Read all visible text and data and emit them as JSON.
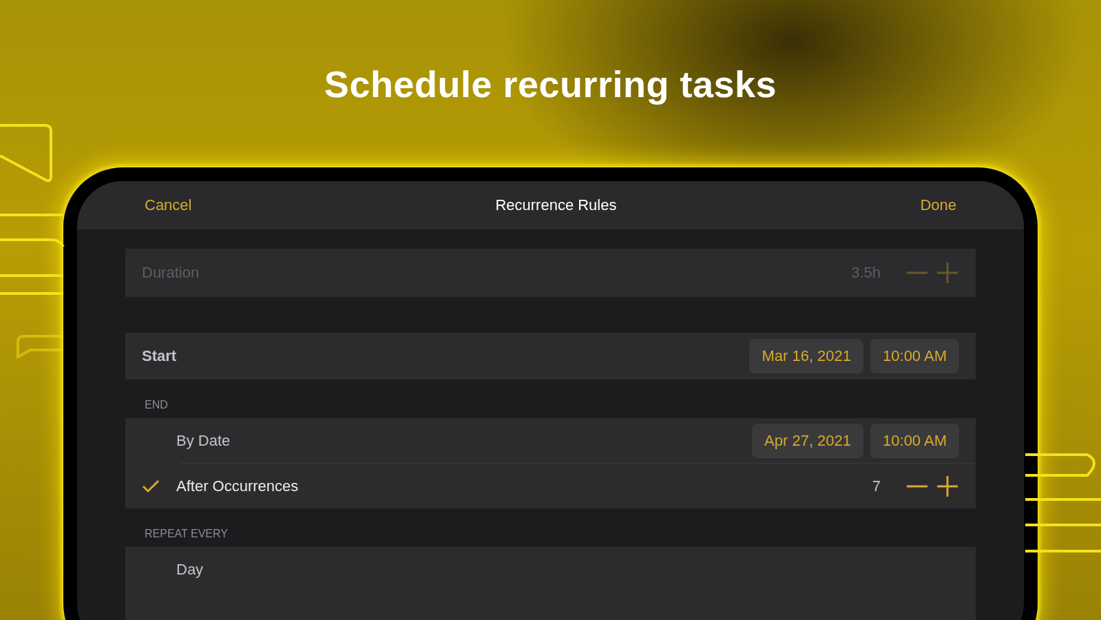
{
  "headline": "Schedule recurring tasks",
  "nav": {
    "cancel": "Cancel",
    "title": "Recurrence Rules",
    "done": "Done"
  },
  "duration": {
    "label": "Duration",
    "value": "3.5h",
    "disabled": true
  },
  "start": {
    "label": "Start",
    "date": "Mar 16, 2021",
    "time": "10:00 AM"
  },
  "end": {
    "header": "END",
    "options": [
      {
        "kind": "date",
        "label": "By Date",
        "selected": false,
        "date": "Apr 27, 2021",
        "time": "10:00 AM"
      },
      {
        "kind": "stepper",
        "label": "After Occurrences",
        "selected": true,
        "value": "7"
      }
    ]
  },
  "repeat": {
    "header": "REPEAT EVERY",
    "options": [
      {
        "label": "Day",
        "selected": false
      }
    ]
  }
}
